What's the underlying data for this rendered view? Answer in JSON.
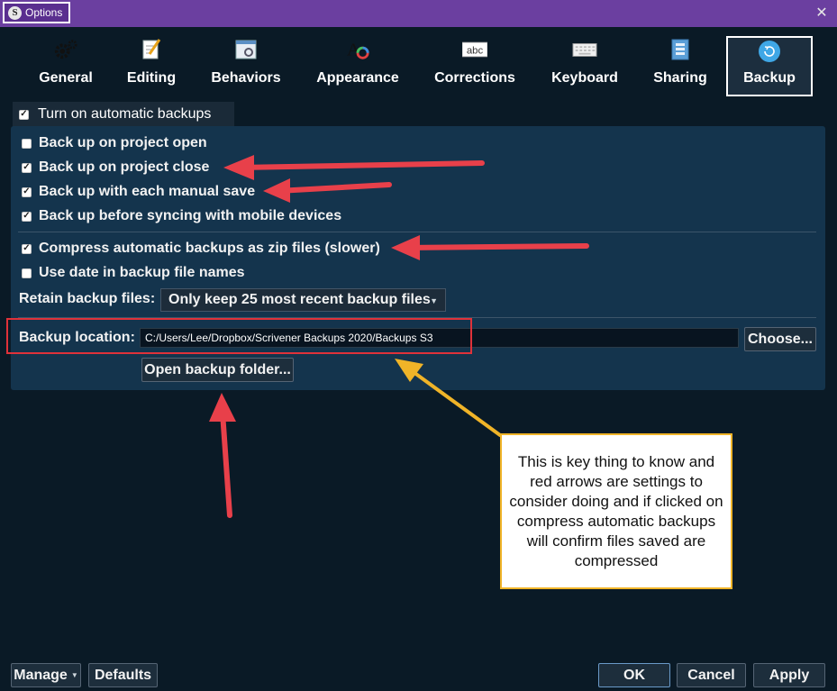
{
  "window": {
    "title": "Options",
    "close_label": "✕",
    "logo_letter": "S"
  },
  "toolbar": {
    "items": [
      {
        "label": "General",
        "icon": "gears-icon"
      },
      {
        "label": "Editing",
        "icon": "edit-pencil-icon"
      },
      {
        "label": "Behaviors",
        "icon": "behaviors-icon"
      },
      {
        "label": "Appearance",
        "icon": "appearance-icon"
      },
      {
        "label": "Corrections",
        "icon": "abc-icon"
      },
      {
        "label": "Keyboard",
        "icon": "keyboard-icon"
      },
      {
        "label": "Sharing",
        "icon": "sharing-icon"
      },
      {
        "label": "Backup",
        "icon": "backup-icon",
        "selected": true
      }
    ],
    "corrections_icon_text": "abc"
  },
  "options": {
    "turn_on_backups": {
      "label": "Turn on automatic backups",
      "checked": true
    },
    "backup_on_open": {
      "label": "Back up on project open",
      "checked": false
    },
    "backup_on_close": {
      "label": "Back up on project close",
      "checked": true
    },
    "backup_on_save": {
      "label": "Back up with each manual save",
      "checked": true
    },
    "backup_before_sync": {
      "label": "Back up before syncing with mobile devices",
      "checked": true
    },
    "compress_backups": {
      "label": "Compress automatic backups as zip files (slower)",
      "checked": true
    },
    "use_date": {
      "label": "Use date in backup file names",
      "checked": false
    },
    "retain_label": "Retain backup files:",
    "retain_value": "Only keep 25 most recent backup files",
    "location_label": "Backup location:",
    "location_value": "C:/Users/Lee/Dropbox/Scrivener Backups 2020/Backups S3",
    "choose_label": "Choose...",
    "open_folder_label": "Open backup folder..."
  },
  "callout": {
    "text": "This is key thing to know and red arrows are settings to consider doing and if clicked on compress automatic backups will confirm files saved are compressed"
  },
  "bottom": {
    "manage_label": "Manage",
    "defaults_label": "Defaults",
    "ok_label": "OK",
    "cancel_label": "Cancel",
    "apply_label": "Apply"
  },
  "colors": {
    "accent_purple": "#6b3fa0",
    "panel_blue": "#14344d",
    "annotation_red": "#e0323a",
    "annotation_orange": "#f0b428"
  }
}
